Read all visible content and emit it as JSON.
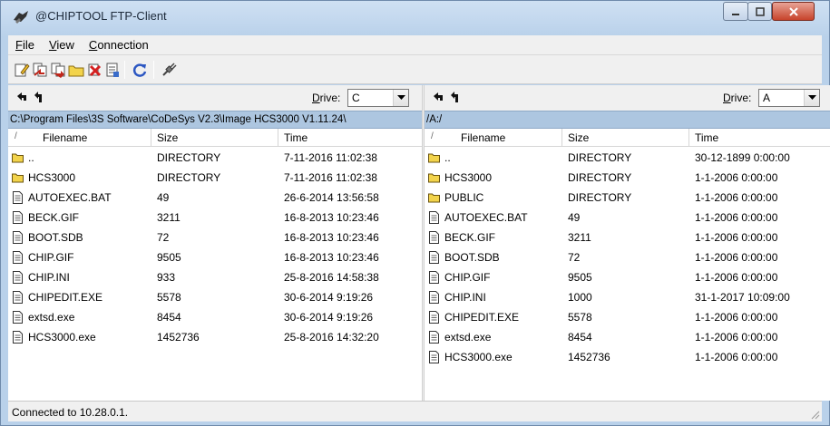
{
  "window": {
    "title": "@CHIPTOOL FTP-Client"
  },
  "menu": [
    {
      "label": "File",
      "key": "F",
      "rest": "ile"
    },
    {
      "label": "View",
      "key": "V",
      "rest": "iew"
    },
    {
      "label": "Connection",
      "key": "C",
      "rest": "onnection"
    }
  ],
  "toolbar": {
    "icons": [
      "edit-icon",
      "copy-left-icon",
      "copy-right-icon",
      "new-folder-icon",
      "delete-icon",
      "properties-icon",
      "refresh-icon",
      "disconnect-icon"
    ]
  },
  "left": {
    "drive_label_key": "D",
    "drive_label_rest": "rive:",
    "drive_value": "C",
    "path": "C:\\Program Files\\3S Software\\CoDeSys V2.3\\Image HCS3000 V1.11.24\\",
    "columns": [
      "Filename",
      "Size",
      "Time"
    ],
    "files": [
      {
        "type": "folder",
        "name": "..",
        "size": "DIRECTORY",
        "time": "7-11-2016 11:02:38"
      },
      {
        "type": "folder",
        "name": "HCS3000",
        "size": "DIRECTORY",
        "time": "7-11-2016 11:02:38"
      },
      {
        "type": "file",
        "name": "AUTOEXEC.BAT",
        "size": "49",
        "time": "26-6-2014 13:56:58"
      },
      {
        "type": "file",
        "name": "BECK.GIF",
        "size": "3211",
        "time": "16-8-2013 10:23:46"
      },
      {
        "type": "file",
        "name": "BOOT.SDB",
        "size": "72",
        "time": "16-8-2013 10:23:46"
      },
      {
        "type": "file",
        "name": "CHIP.GIF",
        "size": "9505",
        "time": "16-8-2013 10:23:46"
      },
      {
        "type": "file",
        "name": "CHIP.INI",
        "size": "933",
        "time": "25-8-2016 14:58:38"
      },
      {
        "type": "file",
        "name": "CHIPEDIT.EXE",
        "size": "5578",
        "time": "30-6-2014 9:19:26"
      },
      {
        "type": "file",
        "name": "extsd.exe",
        "size": "8454",
        "time": "30-6-2014 9:19:26"
      },
      {
        "type": "file",
        "name": "HCS3000.exe",
        "size": "1452736",
        "time": "25-8-2016 14:32:20"
      }
    ]
  },
  "right": {
    "drive_label_key": "D",
    "drive_label_rest": "rive:",
    "drive_value": "A",
    "path": "/A:/",
    "columns": [
      "Filename",
      "Size",
      "Time"
    ],
    "files": [
      {
        "type": "folder",
        "name": "..",
        "size": "DIRECTORY",
        "time": "30-12-1899 0:00:00"
      },
      {
        "type": "folder",
        "name": "HCS3000",
        "size": "DIRECTORY",
        "time": "1-1-2006 0:00:00"
      },
      {
        "type": "folder",
        "name": "PUBLIC",
        "size": "DIRECTORY",
        "time": "1-1-2006 0:00:00"
      },
      {
        "type": "file",
        "name": "AUTOEXEC.BAT",
        "size": "49",
        "time": "1-1-2006 0:00:00"
      },
      {
        "type": "file",
        "name": "BECK.GIF",
        "size": "3211",
        "time": "1-1-2006 0:00:00"
      },
      {
        "type": "file",
        "name": "BOOT.SDB",
        "size": "72",
        "time": "1-1-2006 0:00:00"
      },
      {
        "type": "file",
        "name": "CHIP.GIF",
        "size": "9505",
        "time": "1-1-2006 0:00:00"
      },
      {
        "type": "file",
        "name": "CHIP.INI",
        "size": "1000",
        "time": "31-1-2017 10:09:00"
      },
      {
        "type": "file",
        "name": "CHIPEDIT.EXE",
        "size": "5578",
        "time": "1-1-2006 0:00:00"
      },
      {
        "type": "file",
        "name": "extsd.exe",
        "size": "8454",
        "time": "1-1-2006 0:00:00"
      },
      {
        "type": "file",
        "name": "HCS3000.exe",
        "size": "1452736",
        "time": "1-1-2006 0:00:00"
      }
    ]
  },
  "status": {
    "text": "Connected to 10.28.0.1."
  },
  "colors": {
    "path_bar": "#adc6e0",
    "folder": "#f2d34b",
    "close_button": "#c7432b"
  }
}
